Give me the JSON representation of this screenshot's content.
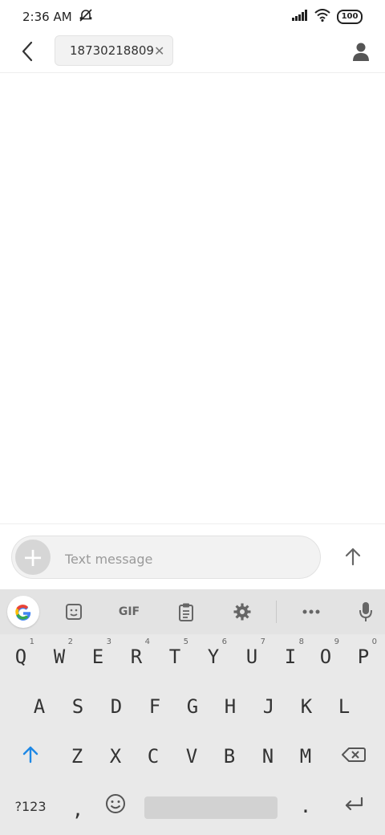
{
  "status_bar": {
    "time": "2:36 AM",
    "battery": "100"
  },
  "header": {
    "recipient": "18730218809"
  },
  "compose": {
    "placeholder": "Text message"
  },
  "keyboard": {
    "toolbar_gif": "GIF",
    "row1": [
      {
        "label": "Q",
        "hint": "1"
      },
      {
        "label": "W",
        "hint": "2"
      },
      {
        "label": "E",
        "hint": "3"
      },
      {
        "label": "R",
        "hint": "4"
      },
      {
        "label": "T",
        "hint": "5"
      },
      {
        "label": "Y",
        "hint": "6"
      },
      {
        "label": "U",
        "hint": "7"
      },
      {
        "label": "I",
        "hint": "8"
      },
      {
        "label": "O",
        "hint": "9"
      },
      {
        "label": "P",
        "hint": "0"
      }
    ],
    "row2": [
      "A",
      "S",
      "D",
      "F",
      "G",
      "H",
      "J",
      "K",
      "L"
    ],
    "row3": [
      "Z",
      "X",
      "C",
      "V",
      "B",
      "N",
      "M"
    ],
    "row4": {
      "symbols": "?123",
      "comma": ",",
      "period": "."
    }
  }
}
